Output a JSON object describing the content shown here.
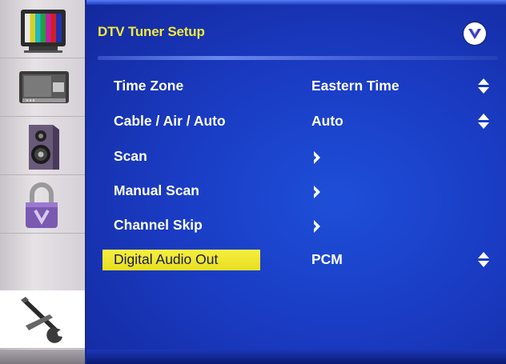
{
  "header": {
    "title": "DTV Tuner Setup",
    "logo_icon": "vizio-v-logo-icon"
  },
  "sidebar": {
    "items": [
      {
        "icon": "tv-picture-icon",
        "active": false
      },
      {
        "icon": "input-display-icon",
        "active": false
      },
      {
        "icon": "speaker-audio-icon",
        "active": false
      },
      {
        "icon": "parental-lock-icon",
        "active": false
      },
      {
        "icon": "wrench-setup-icon",
        "active": true
      }
    ]
  },
  "menu": {
    "rows": [
      {
        "label": "Time Zone",
        "value": "Eastern Time",
        "control": "updown"
      },
      {
        "label": "Cable / Air / Auto",
        "value": "Auto",
        "control": "updown"
      },
      {
        "label": "Scan",
        "value": "",
        "control": "arrow"
      },
      {
        "label": "Manual Scan",
        "value": "",
        "control": "arrow"
      },
      {
        "label": "Channel Skip",
        "value": "",
        "control": "arrow"
      },
      {
        "label": "Digital Audio Out",
        "value": "PCM",
        "control": "updown",
        "selected": true
      }
    ]
  },
  "colors": {
    "panel_blue": "#1a3cc4",
    "title_yellow": "#f2ea3c",
    "highlight_yellow": "#f0e830",
    "text_white": "#ffffff"
  }
}
